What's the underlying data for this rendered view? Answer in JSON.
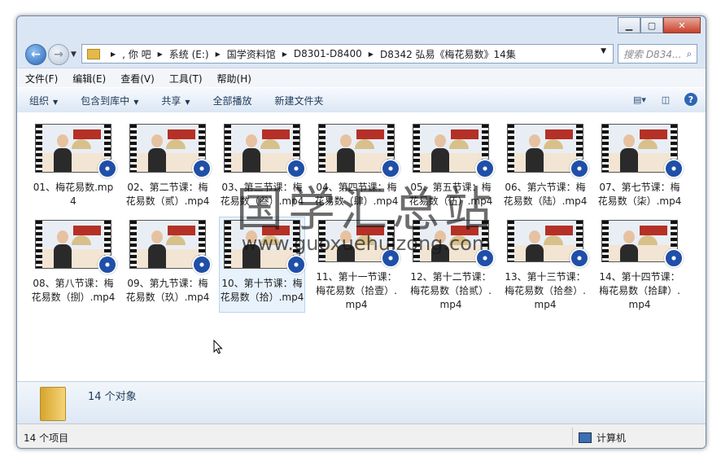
{
  "window": {
    "minimize": "▁",
    "maximize": "▢",
    "close": "✕"
  },
  "address": {
    "parts": [
      ", 你  吧",
      "系统 (E:)",
      "国学资料馆",
      "D8301-D8400",
      "D8342 弘易《梅花易数》14集"
    ]
  },
  "search": {
    "placeholder": "搜索 D834..."
  },
  "menu": [
    "文件(F)",
    "编辑(E)",
    "查看(V)",
    "工具(T)",
    "帮助(H)"
  ],
  "toolbar": {
    "organize": "组织",
    "include": "包含到库中",
    "share": "共享",
    "play_all": "全部播放",
    "new_folder": "新建文件夹"
  },
  "files": [
    "01、梅花易数.mp4",
    "02、第二节课：梅花易数（贰）.mp4",
    "03、第三节课：梅花易数（叁）.mp4",
    "04、第四节课：梅花易数（肆）.mp4",
    "05、第五节课：梅花易数（伍）.mp4",
    "06、第六节课：梅花易数（陆）.mp4",
    "07、第七节课：梅花易数（柒）.mp4",
    "08、第八节课：梅花易数（捌）.mp4",
    "09、第九节课：梅花易数（玖）.mp4",
    "10、第十节课：梅花易数（拾）.mp4",
    "11、第十一节课：梅花易数（拾壹）.mp4",
    "12、第十二节课：梅花易数（拾贰）.mp4",
    "13、第十三节课：梅花易数（拾叁）.mp4",
    "14、第十四节课：梅花易数（拾肆）.mp4"
  ],
  "selected_index": 9,
  "watermark": {
    "text": "国学汇总站",
    "url": "www.guoxuehuizong.com"
  },
  "details": {
    "count": "14 个对象"
  },
  "status": {
    "items": "14 个项目",
    "location": "计算机"
  },
  "colors": {
    "accent": "#2a64b5",
    "selection": "#e8f2fc",
    "reel": "#1f4fa8"
  }
}
